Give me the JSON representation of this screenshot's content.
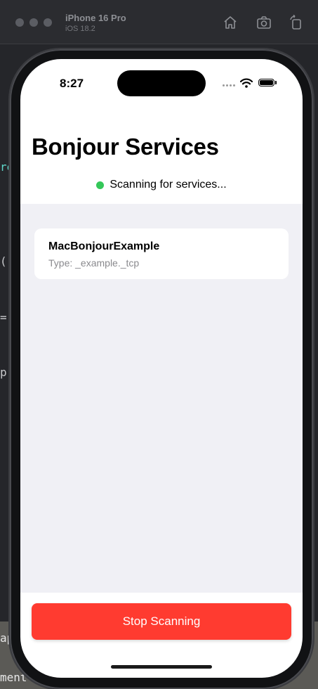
{
  "simulator": {
    "device_name": "iPhone 16 Pro",
    "os_version": "iOS 18.2",
    "icons": [
      "home-icon",
      "screenshot-icon",
      "rotate-icon"
    ]
  },
  "editor_fragments": [
    "re",
    "(",
    "=",
    "p",
    "ap",
    "ment"
  ],
  "status_bar": {
    "time": "8:27"
  },
  "app": {
    "title": "Bonjour Services",
    "scan_status": "Scanning for services...",
    "status_color": "#34c759",
    "services": [
      {
        "name": "MacBonjourExample",
        "type": "Type: _example._tcp"
      }
    ],
    "stop_button_label": "Stop Scanning",
    "accent_color": "#ff3b30"
  }
}
